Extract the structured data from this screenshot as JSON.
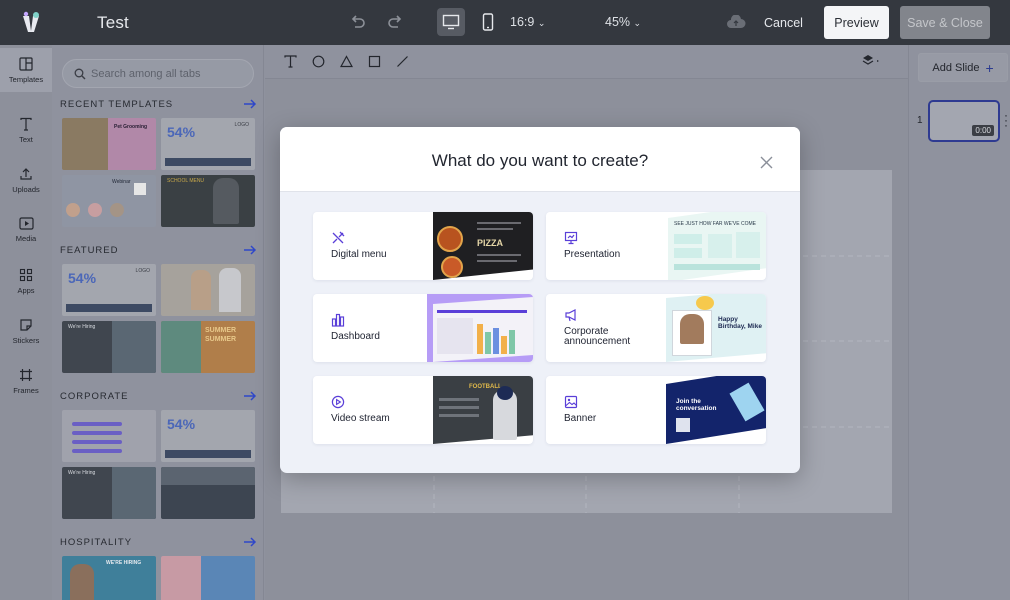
{
  "header": {
    "title": "Test",
    "aspect_ratio": "16:9",
    "zoom": "45%",
    "cancel_label": "Cancel",
    "preview_label": "Preview",
    "save_label": "Save & Close"
  },
  "iconbar": {
    "items": [
      {
        "label": "Templates",
        "icon": "templates-icon"
      },
      {
        "label": "Text",
        "icon": "text-icon"
      },
      {
        "label": "Uploads",
        "icon": "upload-icon"
      },
      {
        "label": "Media",
        "icon": "media-icon"
      },
      {
        "label": "Apps",
        "icon": "apps-icon"
      },
      {
        "label": "Stickers",
        "icon": "sticker-icon"
      },
      {
        "label": "Frames",
        "icon": "frame-icon"
      }
    ]
  },
  "panel": {
    "search_placeholder": "Search among all tabs",
    "sections": [
      {
        "title": "RECENT TEMPLATES"
      },
      {
        "title": "FEATURED"
      },
      {
        "title": "CORPORATE"
      },
      {
        "title": "HOSPITALITY"
      }
    ],
    "thumb_texts": {
      "pet_title": "Pet Grooming",
      "pct": "54%",
      "logo": "LOGO",
      "summer": "SUMMER",
      "hiring": "We're Hiring",
      "school_menu": "SCHOOL MENU",
      "football": "FOOTBALL",
      "webinar": "Webinar",
      "were_hiring_caps": "WE'RE HIRING"
    }
  },
  "right_panel": {
    "add_slide_label": "Add Slide",
    "add_slide_plus": "+",
    "slide_number": "1",
    "slide_duration": "0:00"
  },
  "modal": {
    "title": "What do you want to create?",
    "cards": [
      {
        "label": "Digital menu",
        "icon": "cutlery-icon",
        "img_text": "PIZZA"
      },
      {
        "label": "Presentation",
        "icon": "presentation-icon",
        "img_text": "SEE JUST HOW FAR WE'VE COME"
      },
      {
        "label": "Dashboard",
        "icon": "bar-chart-icon",
        "img_text": ""
      },
      {
        "label": "Corporate announcement",
        "icon": "megaphone-icon",
        "img_text": "Happy Birthday, Mike"
      },
      {
        "label": "Video stream",
        "icon": "play-circle-icon",
        "img_text": "FOOTBALL"
      },
      {
        "label": "Banner",
        "icon": "image-icon",
        "img_text": "Join the conversation"
      }
    ]
  },
  "colors": {
    "accent": "#3f56d9",
    "brand_purple": "#6a4fe3",
    "topbar": "#34383f"
  }
}
